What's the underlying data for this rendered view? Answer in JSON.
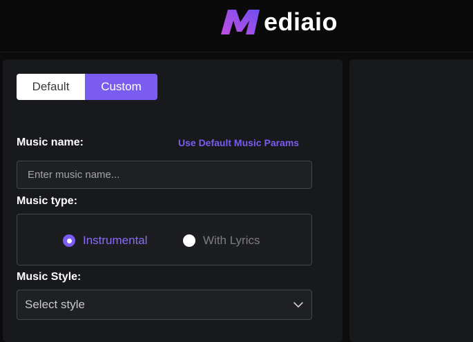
{
  "brand": {
    "name": "ediaio",
    "logo_icon": "mediaio-m-logo",
    "logo_colors": [
      "#c24fe0",
      "#6f4ff0"
    ]
  },
  "mode": {
    "options": [
      "Default",
      "Custom"
    ],
    "selected": "Custom",
    "accent": "#7b5cf0"
  },
  "form": {
    "music_name": {
      "label": "Music name:",
      "link": "Use Default Music Params",
      "placeholder": "Enter music name...",
      "value": ""
    },
    "music_type": {
      "label": "Music type:",
      "options": [
        "Instrumental",
        "With Lyrics"
      ],
      "selected": "Instrumental"
    },
    "music_style": {
      "label": "Music Style:",
      "selected": "Select style",
      "icon": "chevron-down-icon"
    }
  }
}
